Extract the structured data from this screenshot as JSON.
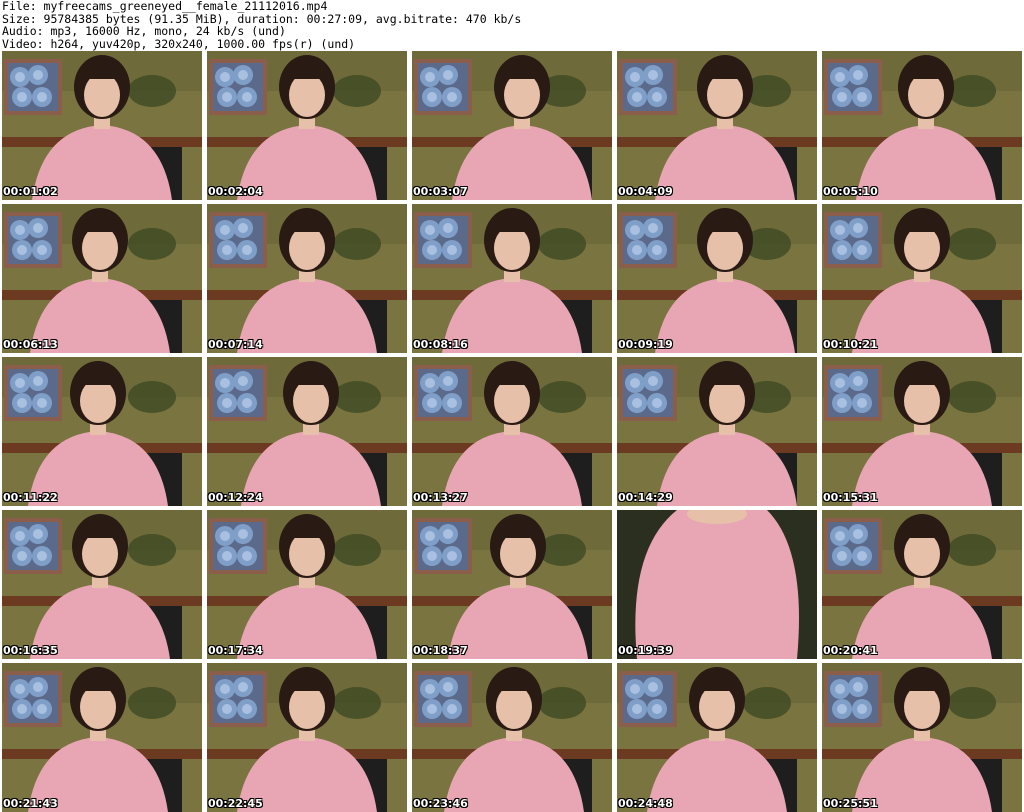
{
  "header": {
    "file": "File: myfreecams_greeneyed__female_21112016.mp4",
    "size": "Size: 95784385 bytes (91.35 MiB), duration: 00:27:09, avg.bitrate: 470 kb/s",
    "audio": "Audio: mp3, 16000 Hz, mono, 24 kb/s (und)",
    "video": "Video: h264, yuv420p, 320x240, 1000.00 fps(r) (und)"
  },
  "colors": {
    "wall": "#7a7440",
    "wall_dark": "#5c5830",
    "frame": "#8a5e4a",
    "roses": "#7f9fc9",
    "stripe": "#6b3a20",
    "sweater": "#e8a6b4",
    "hair": "#2a1a14",
    "skin": "#e6c0a8",
    "chair": "#1e1e1e"
  },
  "thumbnails": [
    {
      "time": "00:01:02"
    },
    {
      "time": "00:02:04"
    },
    {
      "time": "00:03:07"
    },
    {
      "time": "00:04:09"
    },
    {
      "time": "00:05:10"
    },
    {
      "time": "00:06:13"
    },
    {
      "time": "00:07:14"
    },
    {
      "time": "00:08:16"
    },
    {
      "time": "00:09:19"
    },
    {
      "time": "00:10:21"
    },
    {
      "time": "00:11:22"
    },
    {
      "time": "00:12:24"
    },
    {
      "time": "00:13:27"
    },
    {
      "time": "00:14:29"
    },
    {
      "time": "00:15:31"
    },
    {
      "time": "00:16:35"
    },
    {
      "time": "00:17:34"
    },
    {
      "time": "00:18:37"
    },
    {
      "time": "00:19:39"
    },
    {
      "time": "00:20:41"
    },
    {
      "time": "00:21:43"
    },
    {
      "time": "00:22:45"
    },
    {
      "time": "00:23:46"
    },
    {
      "time": "00:24:48"
    },
    {
      "time": "00:25:51"
    }
  ]
}
